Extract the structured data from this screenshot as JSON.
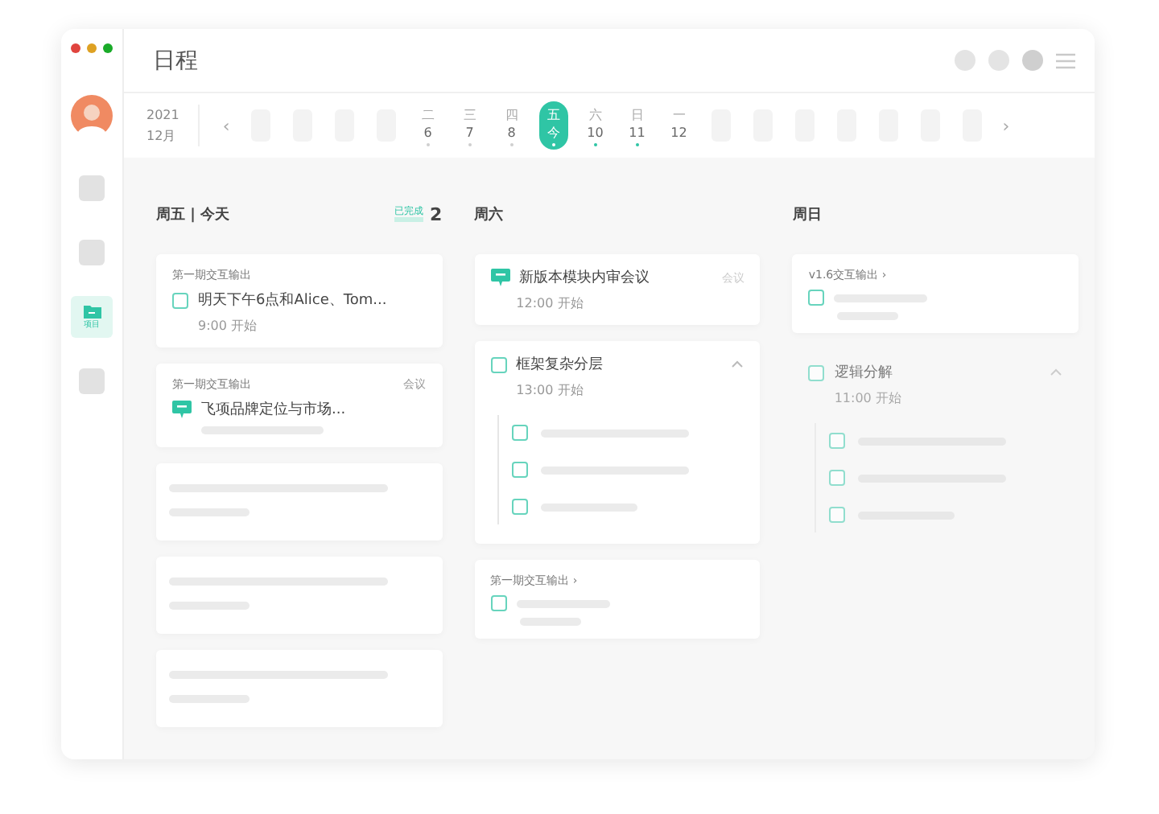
{
  "window": {
    "title": "日程"
  },
  "sidebar": {
    "items": [
      {
        "kind": "avatar"
      },
      {
        "kind": "blank",
        "selected": false
      },
      {
        "kind": "blank",
        "selected": false
      },
      {
        "kind": "folder",
        "label": "项目",
        "selected": true
      },
      {
        "kind": "blank",
        "selected": false
      }
    ]
  },
  "date_strip": {
    "year": "2021",
    "month": "12月",
    "prev": "‹",
    "next": "›",
    "days": [
      {
        "kind": "placeholder"
      },
      {
        "kind": "placeholder"
      },
      {
        "kind": "placeholder"
      },
      {
        "kind": "placeholder"
      },
      {
        "kind": "day",
        "weekday": "二",
        "date": "6",
        "selected": false,
        "color": "#cfcfcf"
      },
      {
        "kind": "day",
        "weekday": "三",
        "date": "7",
        "selected": false,
        "color": "#cfcfcf"
      },
      {
        "kind": "day",
        "weekday": "四",
        "date": "8",
        "selected": false,
        "color": "#cfcfcf"
      },
      {
        "kind": "day",
        "weekday": "五",
        "date": "今",
        "selected": true,
        "color": "#ffffff"
      },
      {
        "kind": "day",
        "weekday": "六",
        "date": "10",
        "selected": false,
        "color": "#2fc5a5"
      },
      {
        "kind": "day",
        "weekday": "日",
        "date": "11",
        "selected": false,
        "color": "#2fc5a5"
      },
      {
        "kind": "day",
        "weekday": "一",
        "date": "12",
        "selected": false
      },
      {
        "kind": "placeholder"
      },
      {
        "kind": "placeholder"
      },
      {
        "kind": "placeholder"
      },
      {
        "kind": "placeholder"
      },
      {
        "kind": "placeholder"
      },
      {
        "kind": "placeholder"
      },
      {
        "kind": "placeholder"
      }
    ]
  },
  "columns": [
    {
      "title": "周五 | 今天",
      "done_label": "已完成",
      "done_count": "2",
      "cards": [
        {
          "kind": "task",
          "project": "第一期交互输出",
          "title": "明天下午6点和Alice、Tom...",
          "time": "9:00 开始",
          "checked": false
        },
        {
          "kind": "meeting",
          "project": "第一期交互输出",
          "tag": "会议",
          "title": "飞项品牌定位与市场..."
        },
        {
          "kind": "skeleton"
        },
        {
          "kind": "skeleton"
        },
        {
          "kind": "skeleton"
        }
      ]
    },
    {
      "title": "周六",
      "cards": [
        {
          "kind": "meeting",
          "tag": "会议",
          "title": "新版本模块内审会议",
          "time": "12:00 开始"
        },
        {
          "kind": "group",
          "title": "框架复杂分层",
          "time": "13:00 开始",
          "expanded": true,
          "dimmed": false,
          "checked": false
        },
        {
          "kind": "project_task",
          "project": "第一期交互输出 ›",
          "checked": false
        }
      ]
    },
    {
      "title": "周日",
      "cards": [
        {
          "kind": "project_task",
          "project": "v1.6交互输出  ›",
          "checked": false
        },
        {
          "kind": "group",
          "title": "逻辑分解",
          "time": "11:00 开始",
          "expanded": true,
          "dimmed": true,
          "checked": false
        }
      ]
    }
  ]
}
